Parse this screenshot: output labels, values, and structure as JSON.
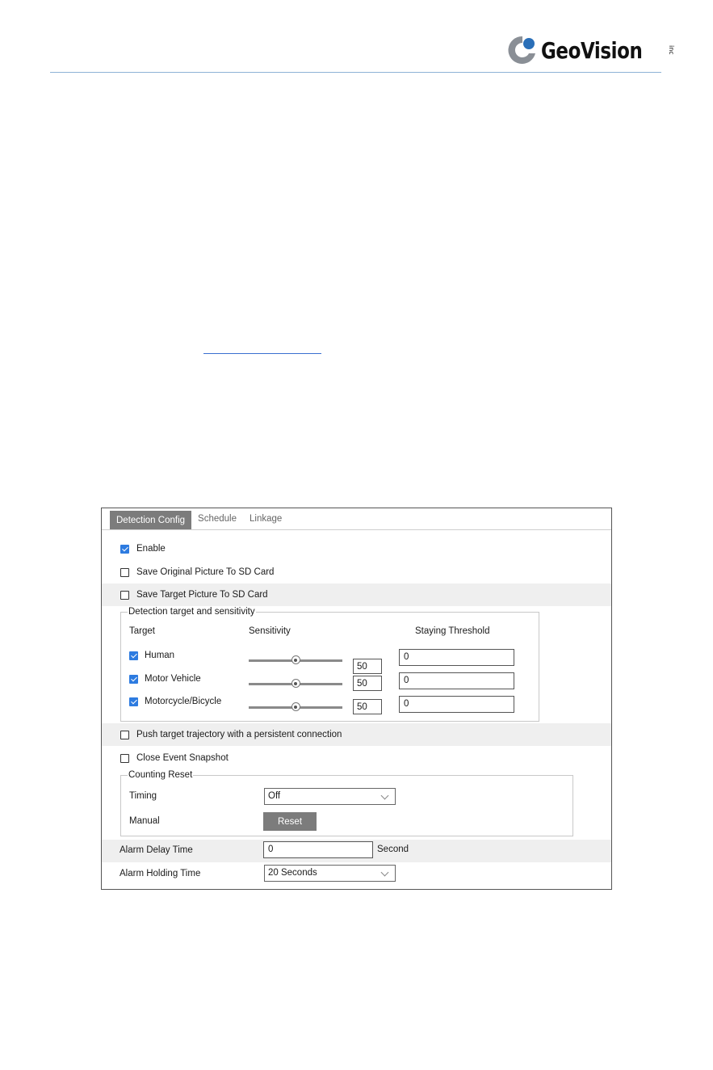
{
  "brand": {
    "name": "GeoVision",
    "suffix": "inc"
  },
  "tabs": [
    "Detection Config",
    "Schedule",
    "Linkage"
  ],
  "options": {
    "enable": {
      "label": "Enable",
      "checked": true
    },
    "save_original": {
      "label": "Save Original Picture To SD Card",
      "checked": false
    },
    "save_target": {
      "label": "Save Target Picture To SD Card",
      "checked": false
    },
    "push_trajectory": {
      "label": "Push target trajectory with a persistent connection",
      "checked": false
    },
    "close_snapshot": {
      "label": "Close Event Snapshot",
      "checked": false
    }
  },
  "detection": {
    "legend": "Detection target and sensitivity",
    "headers": {
      "target": "Target",
      "sensitivity": "Sensitivity",
      "threshold": "Staying Threshold"
    },
    "targets": [
      {
        "label": "Human",
        "checked": true,
        "sensitivity": 50,
        "sensitivity_text": "50",
        "threshold": "0"
      },
      {
        "label": "Motor Vehicle",
        "checked": true,
        "sensitivity": 50,
        "sensitivity_text": "50",
        "threshold": "0"
      },
      {
        "label": "Motorcycle/Bicycle",
        "checked": true,
        "sensitivity": 50,
        "sensitivity_text": "50",
        "threshold": "0"
      }
    ]
  },
  "counting": {
    "legend": "Counting Reset",
    "timing_label": "Timing",
    "timing_value": "Off",
    "manual_label": "Manual",
    "reset_button": "Reset"
  },
  "alarm": {
    "delay_label": "Alarm Delay Time",
    "delay_value": "0",
    "delay_unit": "Second",
    "holding_label": "Alarm Holding Time",
    "holding_value": "20 Seconds"
  },
  "colors": {
    "accent": "#2d7be0",
    "tab_active": "#7c7c7c",
    "row_shade": "#efefef",
    "rule": "#8eb3d6",
    "logo_blue": "#2a6fb8"
  }
}
